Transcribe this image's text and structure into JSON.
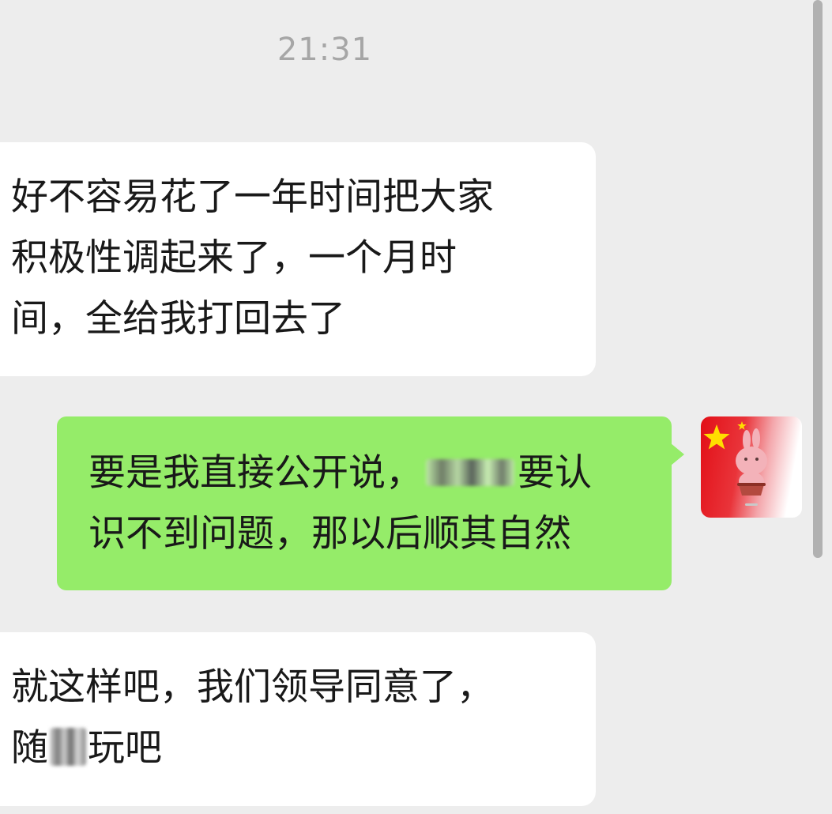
{
  "chat": {
    "timestamp": "21:31",
    "messages": [
      {
        "side": "incoming",
        "lines": [
          "好不容易花了一年时间把大家",
          "积极性调起来了，一个月时",
          "间，全给我打回去了"
        ]
      },
      {
        "side": "outgoing",
        "line1_before": "要是我直接公开说，",
        "line1_after": "要认",
        "line2": "识不到问题，那以后顺其自然"
      },
      {
        "side": "incoming",
        "line1": "就这样吧，我们领导同意了，",
        "line2_before": "随",
        "line2_after": "玩吧"
      }
    ],
    "self_avatar": {
      "icon": "china-flag-rabbit-sticker-avatar-icon",
      "colors": {
        "red": "#e20f17",
        "star": "#ffde00",
        "rabbit": "#f3b2b9"
      }
    },
    "colors": {
      "background": "#ededed",
      "incoming_bubble": "#ffffff",
      "outgoing_bubble": "#95ec69",
      "text": "#191919",
      "timestamp": "#a6a6a6"
    }
  }
}
